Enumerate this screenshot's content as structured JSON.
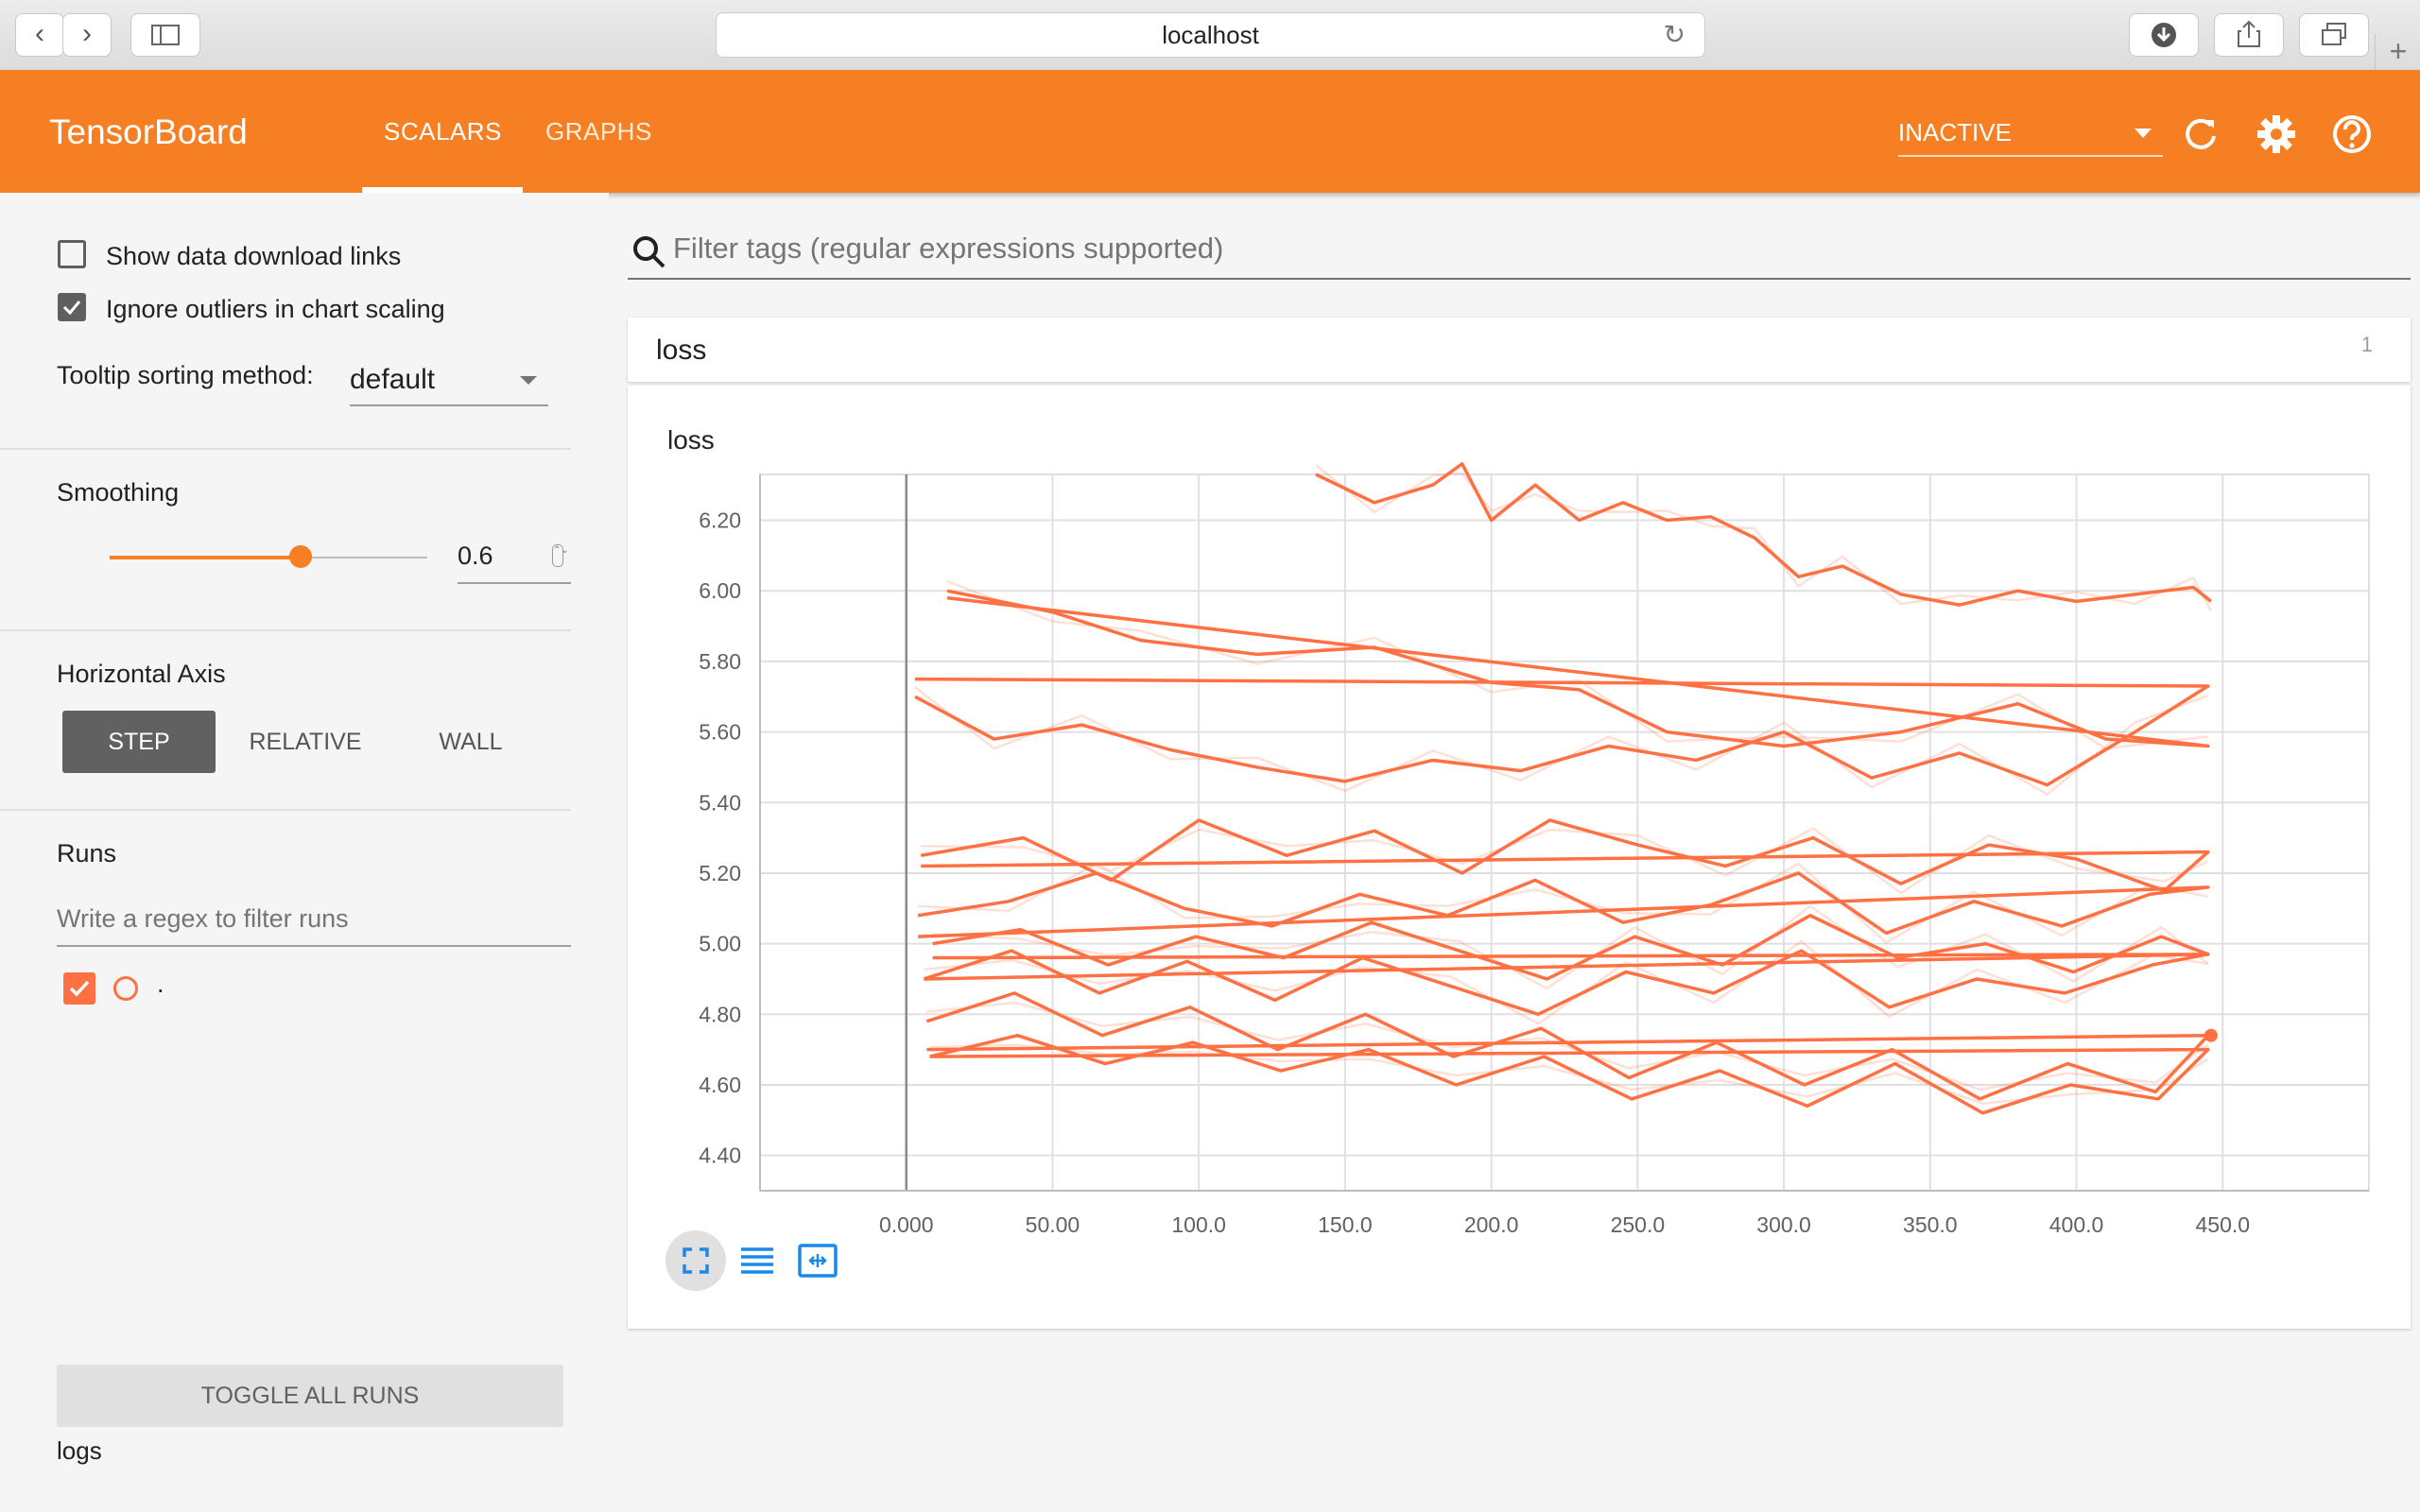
{
  "browser": {
    "url": "localhost"
  },
  "header": {
    "title": "TensorBoard",
    "tabs": [
      {
        "label": "SCALARS"
      },
      {
        "label": "GRAPHS"
      }
    ],
    "run_state": "INACTIVE",
    "accent_color": "#f57f22"
  },
  "sidebar": {
    "show_download_links": {
      "label": "Show data download links",
      "checked": false
    },
    "ignore_outliers": {
      "label": "Ignore outliers in chart scaling",
      "checked": true
    },
    "tooltip_sorting": {
      "label": "Tooltip sorting method:",
      "value": "default"
    },
    "smoothing": {
      "label": "Smoothing",
      "value": "0.6",
      "fraction": 0.6
    },
    "horizontal_axis": {
      "label": "Horizontal Axis",
      "options": [
        "STEP",
        "RELATIVE",
        "WALL"
      ],
      "selected": "STEP"
    },
    "runs": {
      "label": "Runs",
      "filter_placeholder": "Write a regex to filter runs",
      "items": [
        {
          "name": ".",
          "checked": true,
          "color": "#ff7043"
        }
      ],
      "toggle_label": "TOGGLE ALL RUNS",
      "logdir": "logs"
    }
  },
  "main": {
    "filter_placeholder": "Filter tags (regular expressions supported)",
    "category": {
      "name": "loss",
      "count": "1"
    },
    "chart_title": "loss"
  },
  "chart_data": {
    "type": "line",
    "title": "loss",
    "xlabel": "",
    "ylabel": "",
    "xlim": [
      -50,
      500
    ],
    "ylim": [
      4.3,
      6.33
    ],
    "x_ticks": [
      "0.000",
      "50.00",
      "100.0",
      "150.0",
      "200.0",
      "250.0",
      "300.0",
      "350.0",
      "400.0",
      "450.0"
    ],
    "y_ticks": [
      "4.40",
      "4.60",
      "4.80",
      "5.00",
      "5.20",
      "5.40",
      "5.60",
      "5.80",
      "6.00",
      "6.20"
    ],
    "grid": true,
    "series": [
      {
        "color": "#ff7043",
        "x": [
          14,
          50,
          80,
          120,
          160,
          200,
          230,
          260,
          300,
          340,
          380,
          410,
          445
        ],
        "y": [
          6.0,
          5.94,
          5.86,
          5.82,
          5.84,
          5.74,
          5.72,
          5.6,
          5.56,
          5.6,
          5.68,
          5.58,
          5.56
        ],
        "wrap_y": 5.98
      },
      {
        "color": "#ff7043",
        "x": [
          140,
          160,
          180,
          190,
          200,
          215,
          230,
          245,
          260,
          275,
          290,
          305,
          320,
          340,
          360,
          380,
          400,
          420,
          440,
          446
        ],
        "y": [
          6.33,
          6.25,
          6.3,
          6.36,
          6.2,
          6.3,
          6.2,
          6.25,
          6.2,
          6.21,
          6.15,
          6.04,
          6.07,
          5.99,
          5.96,
          6.0,
          5.97,
          5.99,
          6.01,
          5.97
        ],
        "wrap_y": null
      },
      {
        "color": "#ff7043",
        "x": [
          3,
          30,
          60,
          90,
          120,
          150,
          180,
          210,
          240,
          270,
          300,
          330,
          360,
          390,
          420,
          445
        ],
        "y": [
          5.7,
          5.58,
          5.62,
          5.55,
          5.5,
          5.46,
          5.52,
          5.49,
          5.56,
          5.52,
          5.6,
          5.47,
          5.54,
          5.45,
          5.6,
          5.73
        ],
        "wrap_y": 5.75
      },
      {
        "color": "#ff7043",
        "x": [
          5,
          40,
          70,
          100,
          130,
          160,
          190,
          220,
          250,
          280,
          310,
          340,
          370,
          400,
          430,
          445
        ],
        "y": [
          5.25,
          5.3,
          5.18,
          5.35,
          5.25,
          5.32,
          5.2,
          5.35,
          5.28,
          5.22,
          5.3,
          5.17,
          5.28,
          5.24,
          5.15,
          5.26
        ],
        "wrap_y": 5.22
      },
      {
        "color": "#ff7043",
        "x": [
          4,
          35,
          65,
          95,
          125,
          155,
          185,
          215,
          245,
          275,
          305,
          335,
          365,
          395,
          425,
          445
        ],
        "y": [
          5.08,
          5.12,
          5.2,
          5.1,
          5.05,
          5.14,
          5.08,
          5.18,
          5.06,
          5.11,
          5.2,
          5.03,
          5.12,
          5.05,
          5.14,
          5.16
        ],
        "wrap_y": 5.02
      },
      {
        "color": "#ff7043",
        "x": [
          6,
          36,
          66,
          96,
          126,
          156,
          186,
          216,
          246,
          276,
          306,
          336,
          366,
          396,
          426,
          445
        ],
        "y": [
          4.9,
          4.98,
          4.86,
          4.95,
          4.84,
          4.96,
          4.88,
          4.8,
          4.92,
          4.86,
          4.98,
          4.82,
          4.9,
          4.86,
          4.94,
          4.97
        ],
        "wrap_y": 4.9
      },
      {
        "color": "#ff7043",
        "x": [
          7,
          37,
          67,
          97,
          127,
          157,
          187,
          217,
          247,
          277,
          307,
          337,
          367,
          397,
          427,
          445
        ],
        "y": [
          4.78,
          4.86,
          4.74,
          4.82,
          4.7,
          4.8,
          4.68,
          4.76,
          4.62,
          4.72,
          4.6,
          4.7,
          4.56,
          4.66,
          4.58,
          4.74
        ],
        "wrap_y": 4.7
      },
      {
        "color": "#ff7043",
        "x": [
          8,
          38,
          68,
          98,
          128,
          158,
          188,
          218,
          248,
          278,
          308,
          338,
          368,
          398,
          428,
          445
        ],
        "y": [
          4.68,
          4.74,
          4.66,
          4.72,
          4.64,
          4.7,
          4.6,
          4.68,
          4.56,
          4.64,
          4.54,
          4.66,
          4.52,
          4.6,
          4.56,
          4.7
        ],
        "wrap_y": 4.68
      },
      {
        "color": "#ff7043",
        "x": [
          9,
          39,
          69,
          99,
          129,
          159,
          189,
          219,
          249,
          279,
          309,
          339,
          369,
          399,
          429,
          445
        ],
        "y": [
          5.0,
          5.04,
          4.94,
          5.02,
          4.96,
          5.06,
          4.98,
          4.9,
          5.02,
          4.94,
          5.08,
          4.96,
          5.0,
          4.92,
          5.02,
          4.97
        ],
        "wrap_y": 4.96
      }
    ],
    "last_point": {
      "x": 446,
      "y": 4.74
    }
  }
}
